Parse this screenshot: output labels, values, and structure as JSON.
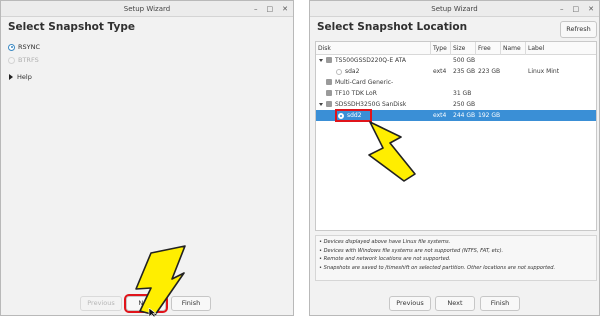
{
  "left_window": {
    "title": "Setup Wizard",
    "heading": "Select Snapshot Type",
    "options": [
      {
        "label": "RSYNC",
        "selected": true,
        "enabled": true
      },
      {
        "label": "BTRFS",
        "selected": false,
        "enabled": false
      }
    ],
    "help_label": "Help",
    "buttons": {
      "previous": "Previous",
      "next": "Next",
      "finish": "Finish"
    }
  },
  "right_window": {
    "title": "Setup Wizard",
    "heading": "Select Snapshot Location",
    "refresh_label": "Refresh",
    "columns": [
      "Disk",
      "Type",
      "Size",
      "Free",
      "Name",
      "Label"
    ],
    "rows": [
      {
        "kind": "disk",
        "disk": "TS500GSSD220Q-E ATA",
        "type": "",
        "size": "500 GB",
        "free": "",
        "name": "",
        "label": ""
      },
      {
        "kind": "partition",
        "disk": "sda2",
        "type": "ext4",
        "size": "235 GB",
        "free": "223 GB",
        "name": "",
        "label": "Linux Mint"
      },
      {
        "kind": "disk-flat",
        "disk": "Multi-Card Generic-",
        "type": "",
        "size": "",
        "free": "",
        "name": "",
        "label": ""
      },
      {
        "kind": "disk-flat",
        "disk": "TF10 TDK LoR",
        "type": "",
        "size": "31 GB",
        "free": "",
        "name": "",
        "label": ""
      },
      {
        "kind": "disk",
        "disk": "SDSSDH3250G SanDisk",
        "type": "",
        "size": "250 GB",
        "free": "",
        "name": "",
        "label": ""
      },
      {
        "kind": "partition-selected",
        "disk": "sdd2",
        "type": "ext4",
        "size": "244 GB",
        "free": "192 GB",
        "name": "",
        "label": ""
      }
    ],
    "notes": [
      "• Devices displayed above have Linux file systems.",
      "• Devices with Windows file systems are not supported (NTFS, FAT, etc).",
      "• Remote and network locations are not supported.",
      "• Snapshots are saved to /timeshift on selected partition. Other locations are not supported."
    ],
    "buttons": {
      "previous": "Previous",
      "next": "Next",
      "finish": "Finish"
    }
  },
  "window_controls": [
    "–",
    "□",
    "✕"
  ],
  "colors": {
    "selection": "#3a8fd6",
    "annotation_red": "#e0141b",
    "arrow_yellow": "#ffee00"
  }
}
